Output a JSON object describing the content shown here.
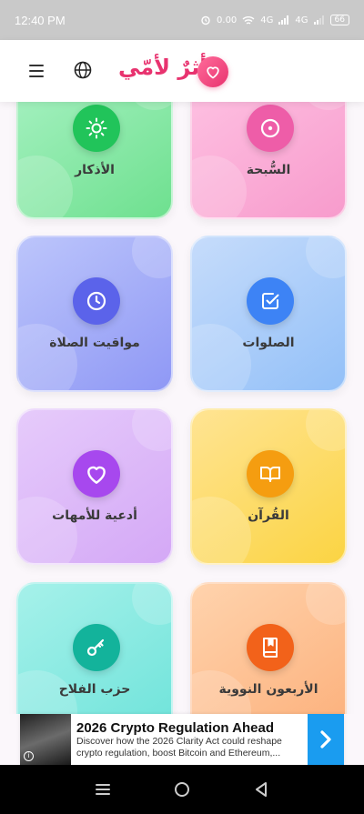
{
  "status_bar": {
    "time": "12:40 PM",
    "speed": "0.00",
    "network1": "4G",
    "network2": "4G",
    "battery": "66"
  },
  "header": {
    "title": "أثرٌ لأمّي",
    "menu_icon": "hamburger-menu-icon",
    "language_icon": "globe-icon",
    "logo_icon": "heart-icon"
  },
  "colors": {
    "brand": "#e8336f"
  },
  "cards": [
    {
      "label": "السُّبحة",
      "icon": "circle-dot-icon",
      "icon_color": "#ee5da8",
      "bg": [
        "#ffc4e4",
        "#f79bcc"
      ]
    },
    {
      "label": "الأذكار",
      "icon": "sun-icon",
      "icon_color": "#21c45a",
      "bg": [
        "#a9f2c4",
        "#6ee08f"
      ]
    },
    {
      "label": "الصلوات",
      "icon": "check-square-icon",
      "icon_color": "#3d83f5",
      "bg": [
        "#c6dcfb",
        "#93c0f8"
      ]
    },
    {
      "label": "مواقيت الصلاة",
      "icon": "clock-icon",
      "icon_color": "#5b63ea",
      "bg": [
        "#bcc5fb",
        "#8f98f5"
      ]
    },
    {
      "label": "القُرآن",
      "icon": "book-open-icon",
      "icon_color": "#f59d10",
      "bg": [
        "#ffe493",
        "#fbd443"
      ]
    },
    {
      "label": "أدعية للأمهات",
      "icon": "heart-icon",
      "icon_color": "#a748ee",
      "bg": [
        "#e6cbfb",
        "#d4a8f6"
      ]
    },
    {
      "label": "الأربعون النووية",
      "icon": "bookmark-book-icon",
      "icon_color": "#f2621a",
      "bg": [
        "#ffd3ad",
        "#fcb07b"
      ]
    },
    {
      "label": "حزب الفلاح",
      "icon": "key-icon",
      "icon_color": "#13b39b",
      "bg": [
        "#a6f1ea",
        "#6ee3da"
      ]
    }
  ],
  "ad": {
    "title": "2026 Crypto Regulation Ahead",
    "description": "Discover how the 2026 Clarity Act could reshape crypto regulation, boost Bitcoin and Ethereum,...",
    "info_icon": "info-icon",
    "cta_icon": "chevron-right-icon"
  },
  "nav": {
    "recents_icon": "recents-icon",
    "home_icon": "home-icon",
    "back_icon": "back-icon"
  }
}
